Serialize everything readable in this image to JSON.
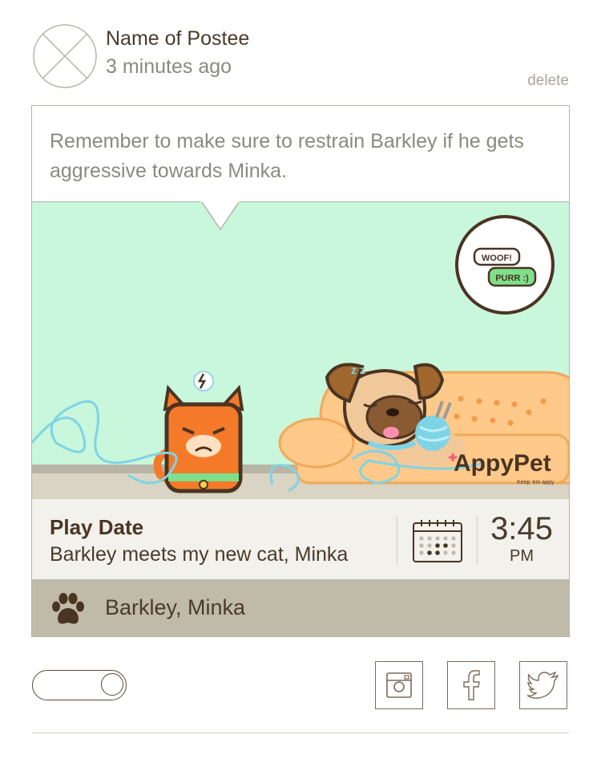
{
  "post": {
    "poster_name": "Name of Postee",
    "time_ago": "3 minutes ago",
    "delete_label": "delete",
    "message": "Remember to make sure to restrain Barkley if he gets aggressive towards Minka."
  },
  "illustration": {
    "badge_woof": "WOOF!",
    "badge_purr": "PURR :)",
    "brand_name": "AppyPet",
    "brand_tagline": "Keep 'em appy",
    "sleep_text": "z z",
    "colors": {
      "wall": "#c9f7dc",
      "floor": "#d9d4c3",
      "sofa": "#ffc98a",
      "cat": "#f47a2a",
      "yarn": "#7ed4e6"
    }
  },
  "event": {
    "title": "Play Date",
    "description": "Barkley meets my new cat, Minka",
    "time": "3:45",
    "ampm": "PM"
  },
  "pets": {
    "names": "Barkley, Minka"
  },
  "share": {
    "icons": [
      "instagram-icon",
      "facebook-icon",
      "twitter-icon"
    ]
  },
  "colors": {
    "accent": "#4a3422",
    "bar": "#c0baa8",
    "event_bg": "#f2f1ec"
  }
}
